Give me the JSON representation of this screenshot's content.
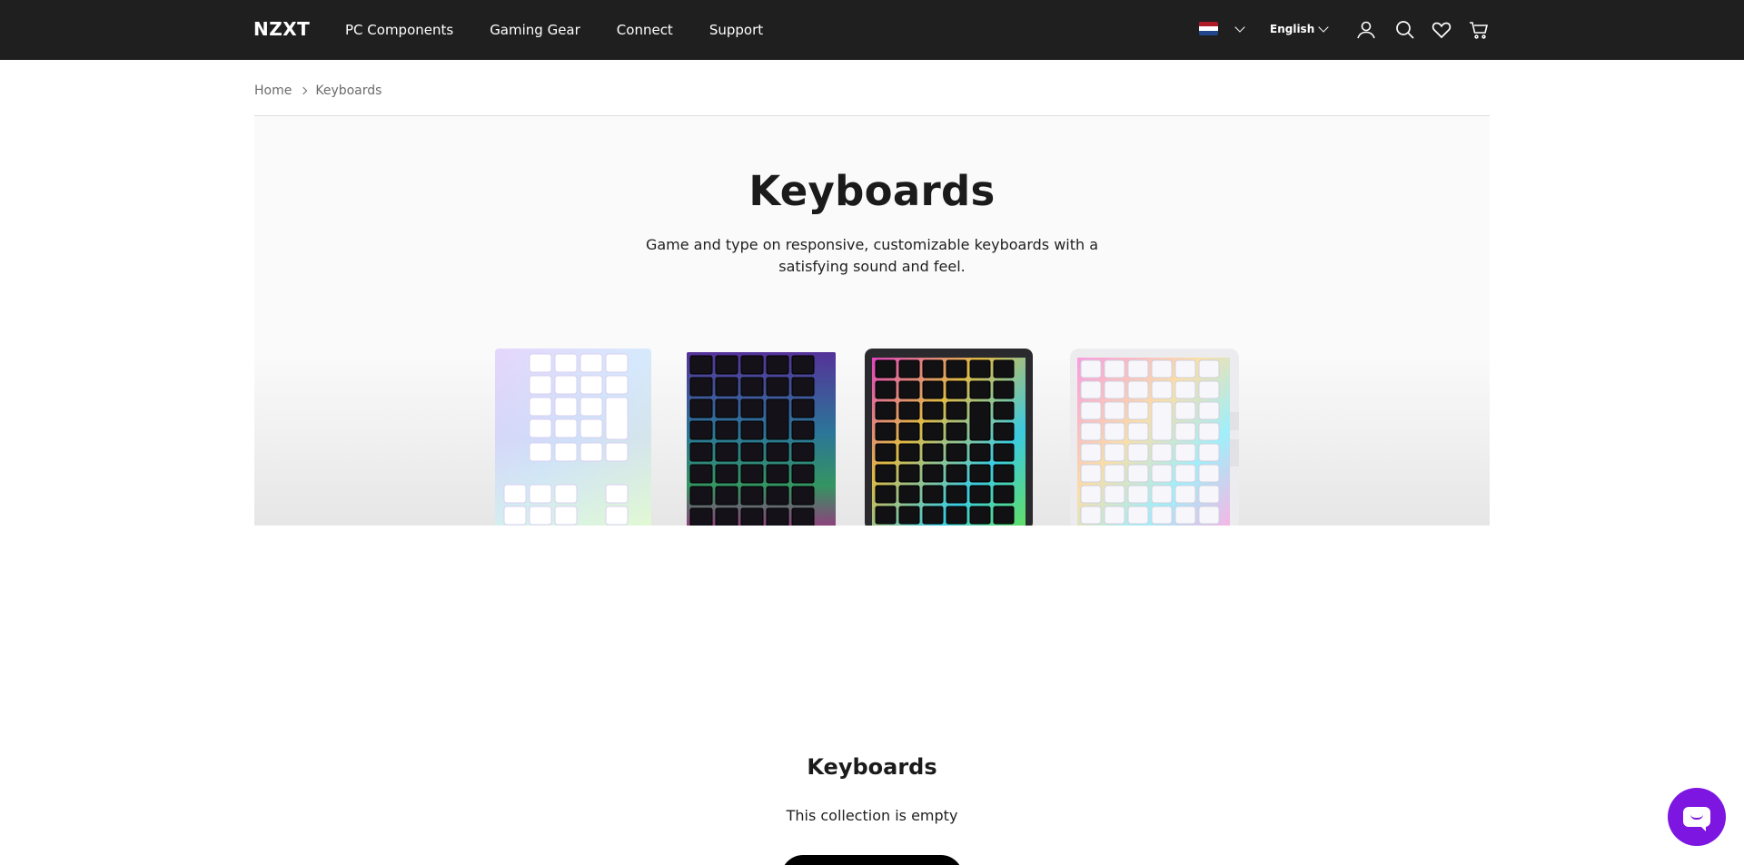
{
  "header": {
    "logo": "NZXT",
    "nav": [
      "PC Components",
      "Gaming Gear",
      "Connect",
      "Support"
    ],
    "region": {
      "flag": "netherlands-flag",
      "flag_colors": [
        "#AE1C28",
        "#FFFFFF",
        "#21468B"
      ]
    },
    "language": "English",
    "icons": [
      "account-icon",
      "search-icon",
      "wishlist-heart-icon",
      "cart-icon"
    ]
  },
  "breadcrumb": {
    "home": "Home",
    "current": "Keyboards"
  },
  "hero": {
    "title": "Keyboards",
    "subtitle": "Game and type on responsive, customizable keyboards with a satisfying sound and feel.",
    "images": [
      "white-rgb-keyboard",
      "black-rgb-keyboard",
      "black-rgb-keyboard-frame",
      "white-rgb-keyboard-frame"
    ]
  },
  "collection": {
    "title": "Keyboards",
    "empty_message": "This collection is empty"
  },
  "colors": {
    "header_bg": "#1F1F1F",
    "chat_accent": "#7C16E0"
  }
}
